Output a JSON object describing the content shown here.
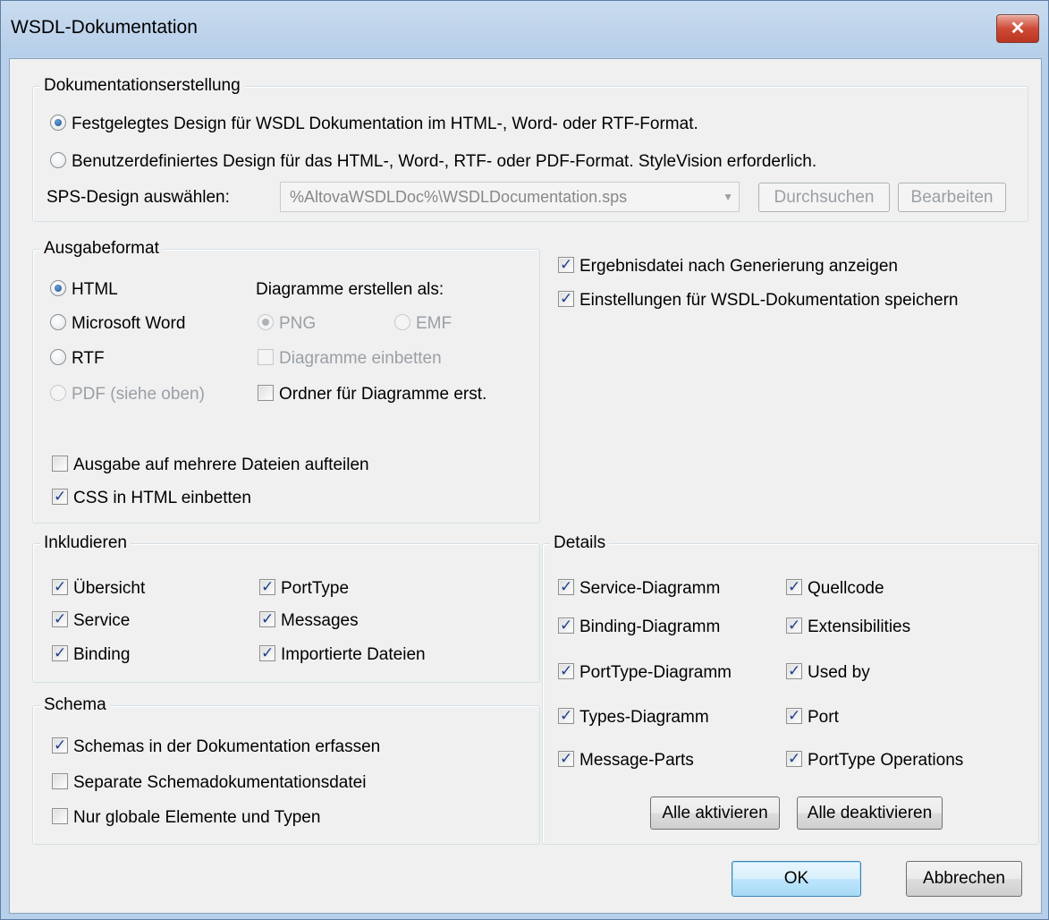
{
  "window": {
    "title": "WSDL-Dokumentation",
    "close_label": "✕"
  },
  "doc_creation": {
    "legend": "Dokumentationserstellung",
    "option_fixed": "Festgelegtes Design für WSDL Dokumentation im HTML-, Word- oder RTF-Format.",
    "option_custom": "Benutzerdefiniertes Design für das HTML-, Word-, RTF- oder PDF-Format. StyleVision erforderlich.",
    "sps_label": "SPS-Design auswählen:",
    "sps_value": "%AltovaWSDLDoc%\\WSDLDocumentation.sps",
    "browse_label": "Durchsuchen",
    "edit_label": "Bearbeiten"
  },
  "output_format": {
    "legend": "Ausgabeformat",
    "html": "HTML",
    "word": "Microsoft Word",
    "rtf": "RTF",
    "pdf": "PDF (siehe oben)",
    "diagrams_heading": "Diagramme erstellen als:",
    "png": "PNG",
    "emf": "EMF",
    "embed_diagrams": "Diagramme einbetten",
    "create_folder": "Ordner für Diagramme erst.",
    "split_output": "Ausgabe auf mehrere Dateien aufteilen",
    "embed_css": "CSS in HTML einbetten"
  },
  "options": {
    "show_result": "Ergebnisdatei nach Generierung anzeigen",
    "save_settings": "Einstellungen für WSDL-Dokumentation speichern"
  },
  "include": {
    "legend": "Inkludieren",
    "overview": "Übersicht",
    "service": "Service",
    "binding": "Binding",
    "porttype": "PortType",
    "messages": "Messages",
    "imported": "Importierte Dateien"
  },
  "details": {
    "legend": "Details",
    "service_diagram": "Service-Diagramm",
    "binding_diagram": "Binding-Diagramm",
    "porttype_diagram": "PortType-Diagramm",
    "types_diagram": "Types-Diagramm",
    "message_parts": "Message-Parts",
    "source": "Quellcode",
    "extensibilities": "Extensibilities",
    "used_by": "Used by",
    "port": "Port",
    "porttype_operations": "PortType Operations",
    "enable_all": "Alle aktivieren",
    "disable_all": "Alle deaktivieren"
  },
  "schema": {
    "legend": "Schema",
    "include_schemas": "Schemas in der Dokumentation erfassen",
    "separate_file": "Separate Schemadokumentationsdatei",
    "global_only": "Nur globale Elemente und Typen"
  },
  "footer": {
    "ok": "OK",
    "cancel": "Abbrechen"
  }
}
